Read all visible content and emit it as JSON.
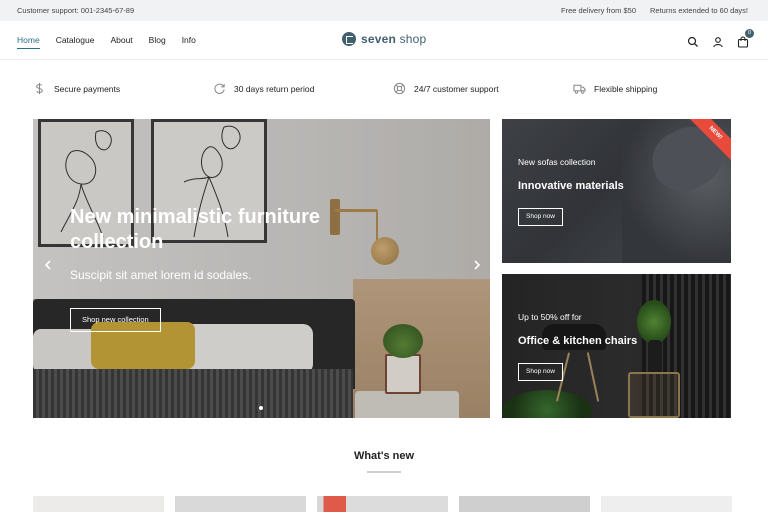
{
  "topbar": {
    "support": "Customer support: 001-2345-67-89",
    "delivery": "Free delivery from $50",
    "returns": "Returns extended to 60 days!"
  },
  "nav": {
    "items": [
      "Home",
      "Catalogue",
      "About",
      "Blog",
      "Info"
    ],
    "active": "Home"
  },
  "logo": {
    "brand": "seven",
    "suffix": " shop"
  },
  "header_icons": {
    "search": "search-icon",
    "account": "user-icon",
    "cart": "cart-icon",
    "cart_count": "0"
  },
  "features": [
    {
      "icon": "dollar-icon",
      "label": "Secure payments"
    },
    {
      "icon": "return-icon",
      "label": "30 days return period"
    },
    {
      "icon": "support-icon",
      "label": "24/7 customer support"
    },
    {
      "icon": "truck-icon",
      "label": "Flexible shipping"
    }
  ],
  "hero": {
    "title": "New minimalistic furniture collection",
    "subtitle": "Suscipit sit amet lorem id sodales.",
    "button": "Shop new collection"
  },
  "cards": [
    {
      "pre": "New sofas collection",
      "title": "Innovative materials",
      "button": "Shop now",
      "ribbon": "NEW!"
    },
    {
      "pre": "Up to 50% off for",
      "title": "Office & kitchen chairs",
      "button": "Shop now"
    }
  ],
  "section": {
    "title": "What's new"
  },
  "colors": {
    "accent": "#2a6f86",
    "logo": "#41606e",
    "ribbon": "#e84a3b",
    "topbar_bg": "#f1f2f4"
  }
}
